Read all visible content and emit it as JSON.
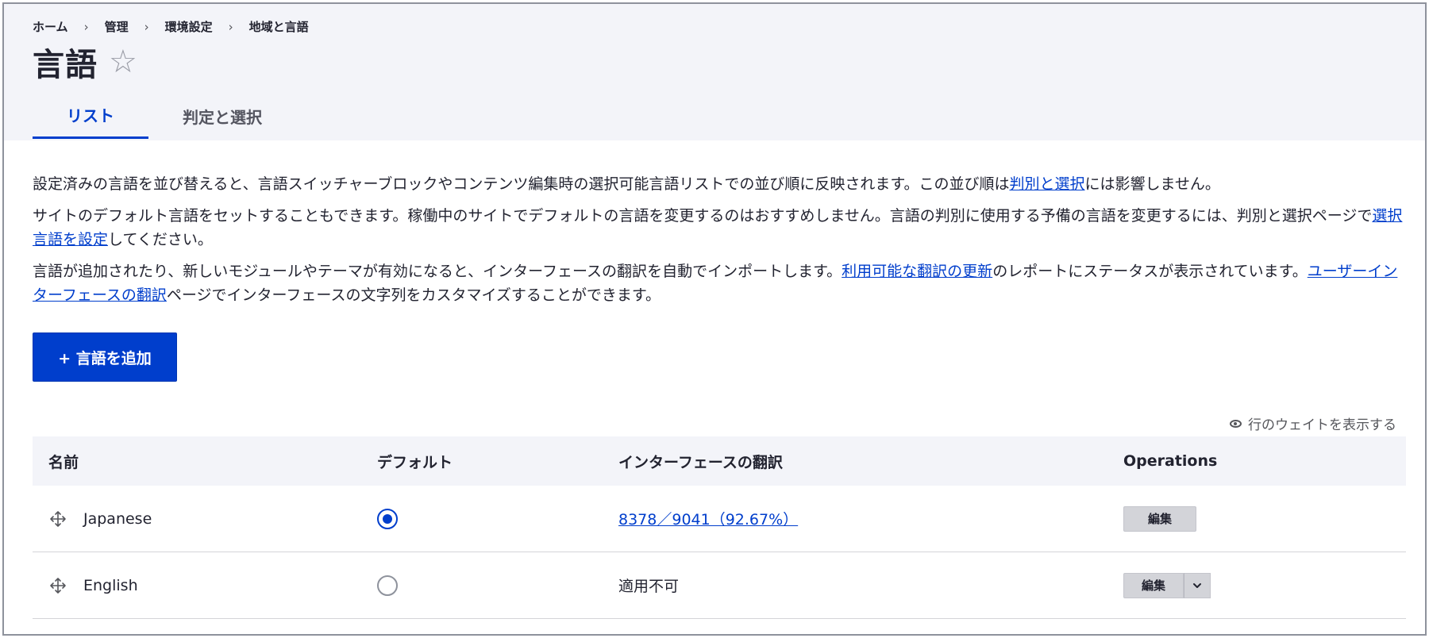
{
  "breadcrumb": {
    "items": [
      "ホーム",
      "管理",
      "環境設定",
      "地域と言語"
    ],
    "separator": "›"
  },
  "page": {
    "title": "言語",
    "favorite_icon": "☆"
  },
  "tabs": [
    {
      "label": "リスト",
      "active": true
    },
    {
      "label": "判定と選択",
      "active": false
    }
  ],
  "description": {
    "p1_before": "設定済みの言語を並び替えると、言語スイッチャーブロックやコンテンツ編集時の選択可能言語リストでの並び順に反映されます。この並び順は",
    "p1_link": "判別と選択",
    "p1_after": "には影響しません。",
    "p2_before": "サイトのデフォルト言語をセットすることもできます。稼働中のサイトでデフォルトの言語を変更するのはおすすめしません。言語の判別に使用する予備の言語を変更するには、判別と選択ページで",
    "p2_link": "選択言語を設定",
    "p2_after": "してください。",
    "p3_before": "言語が追加されたり、新しいモジュールやテーマが有効になると、インターフェースの翻訳を自動でインポートします。",
    "p3_link1": "利用可能な翻訳の更新",
    "p3_mid": "のレポートにステータスが表示されています。",
    "p3_link2": "ユーザーインターフェースの翻訳",
    "p3_after": "ページでインターフェースの文字列をカスタマイズすることができます。"
  },
  "actions": {
    "add_language_label": "+ 言語を追加",
    "show_weights_label": "行のウェイトを表示する"
  },
  "table": {
    "headers": {
      "name": "名前",
      "default": "デフォルト",
      "translation": "インターフェースの翻訳",
      "operations": "Operations"
    },
    "rows": [
      {
        "name": "Japanese",
        "default": true,
        "translation": "8378／9041（92.67%）",
        "translation_is_link": true,
        "edit_label": "編集",
        "has_dropdown": false
      },
      {
        "name": "English",
        "default": false,
        "translation": "適用不可",
        "translation_is_link": false,
        "edit_label": "編集",
        "has_dropdown": true
      }
    ]
  },
  "colors": {
    "accent": "#003ecc",
    "header_bg": "#f3f4f9",
    "button_gray": "#d3d4d9"
  }
}
